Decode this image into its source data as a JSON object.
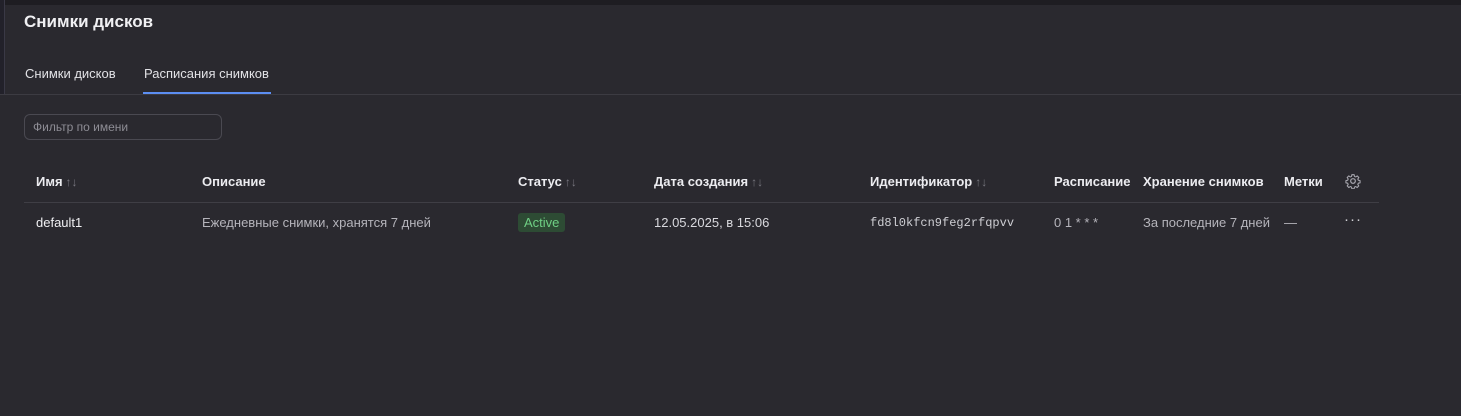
{
  "page": {
    "title": "Снимки дисков"
  },
  "tabs": [
    {
      "label": "Снимки дисков",
      "active": false
    },
    {
      "label": "Расписания снимков",
      "active": true
    }
  ],
  "filter": {
    "placeholder": "Фильтр по имени",
    "value": ""
  },
  "table": {
    "columns": [
      {
        "label": "Имя",
        "sortable": true
      },
      {
        "label": "Описание",
        "sortable": false
      },
      {
        "label": "Статус",
        "sortable": true
      },
      {
        "label": "Дата создания",
        "sortable": true
      },
      {
        "label": "Идентификатор",
        "sortable": true
      },
      {
        "label": "Расписание",
        "sortable": false
      },
      {
        "label": "Хранение снимков",
        "sortable": false
      },
      {
        "label": "Метки",
        "sortable": false
      }
    ],
    "sort_glyph": "↑↓",
    "rows": [
      {
        "name": "default1",
        "description": "Ежедневные снимки, хранятся 7 дней",
        "status": "Active",
        "created": "12.05.2025, в 15:06",
        "id": "fd8l0kfcn9feg2rfqpvv",
        "schedule": "0 1 * * *",
        "retention": "За последние 7 дней",
        "labels": "—",
        "actions": "···"
      }
    ]
  },
  "colors": {
    "background": "#2a292f",
    "accent": "#5c8ef2",
    "status_active_bg": "#2d4b34",
    "status_active_text": "#6fcf84"
  },
  "icons": {
    "settings": "gear-icon",
    "row_actions": "more-horizontal-icon"
  }
}
